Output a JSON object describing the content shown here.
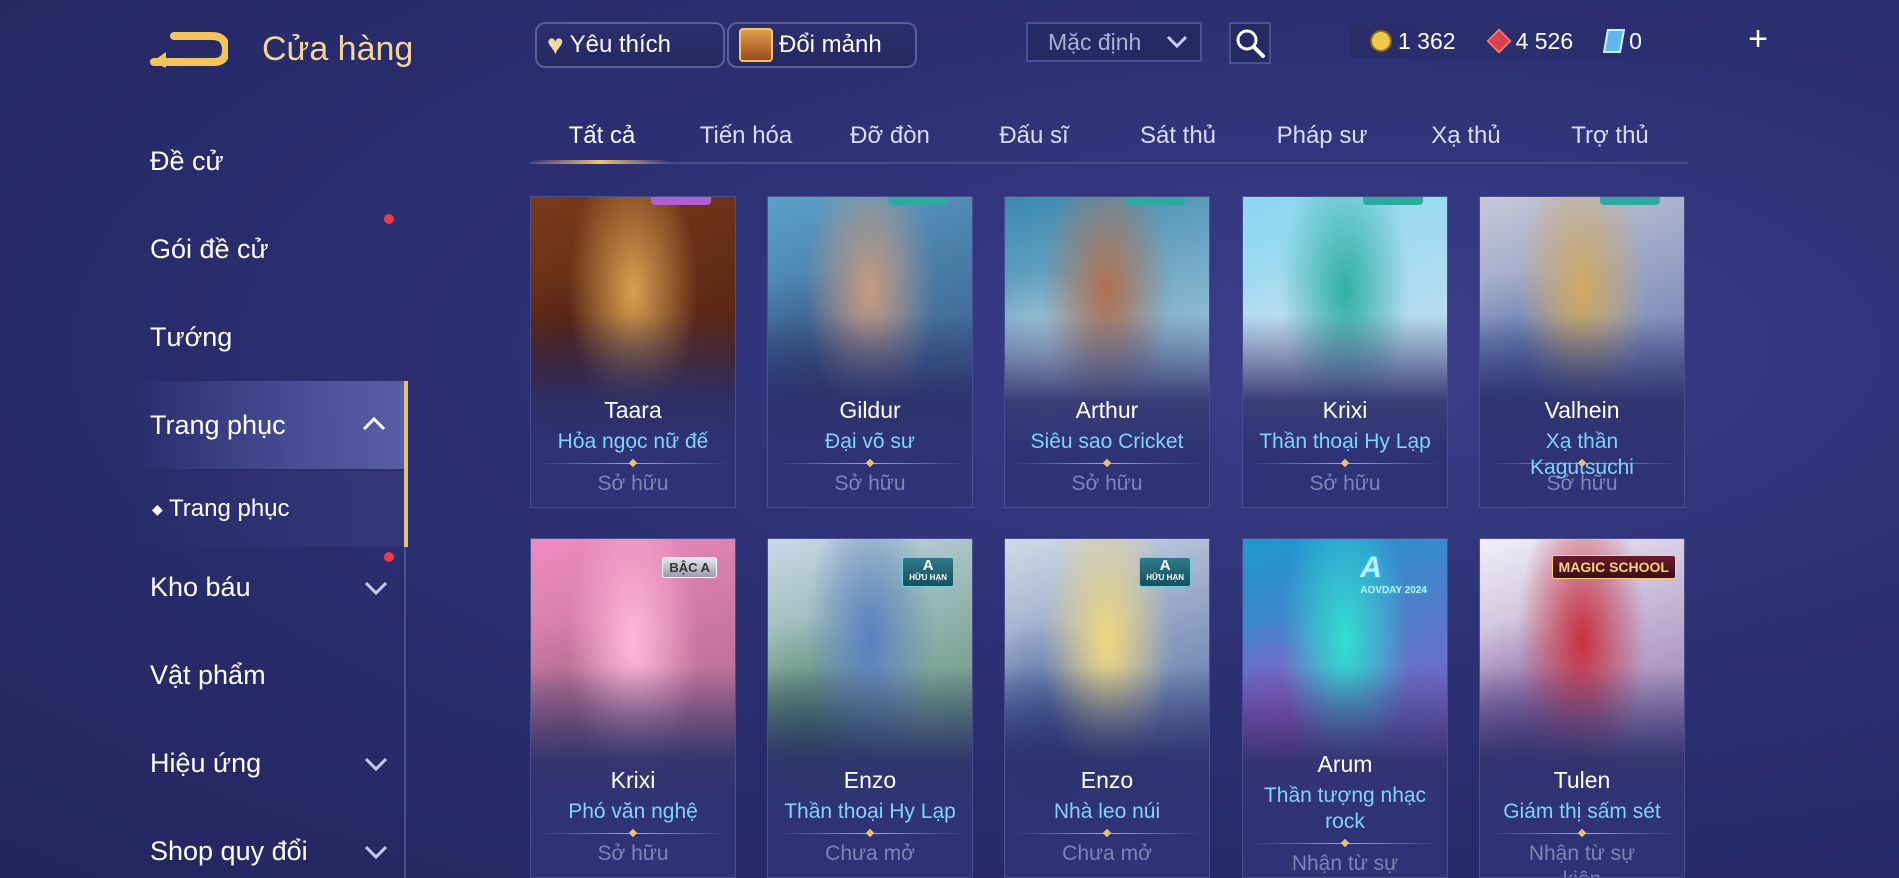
{
  "header": {
    "title": "Cửa hàng",
    "favorite_label": "Yêu thích",
    "fragment_label": "Đổi mảnh",
    "sort": {
      "selected": "Mặc định"
    },
    "currencies": {
      "gold": "1 362",
      "gems": "4 526",
      "vouchers": "0"
    }
  },
  "sidebar": {
    "items": [
      {
        "label": "Đề cử"
      },
      {
        "label": "Gói đề cử"
      },
      {
        "label": "Tướng"
      },
      {
        "label": "Trang phục"
      },
      {
        "label": "Trang phục"
      },
      {
        "label": "Kho báu"
      },
      {
        "label": "Vật phẩm"
      },
      {
        "label": "Hiệu ứng"
      },
      {
        "label": "Shop quy đổi"
      }
    ]
  },
  "tabs": [
    {
      "label": "Tất cả"
    },
    {
      "label": "Tiến hóa"
    },
    {
      "label": "Đỡ đòn"
    },
    {
      "label": "Đấu sĩ"
    },
    {
      "label": "Sát thủ"
    },
    {
      "label": "Pháp sư"
    },
    {
      "label": "Xạ thủ"
    },
    {
      "label": "Trợ thủ"
    }
  ],
  "cards": [
    {
      "hero": "Taara",
      "skin": "Hỏa ngọc nữ đế",
      "status": "Sở hữu",
      "colors": [
        "#7a3a1a",
        "#d8a050",
        "#3a1410"
      ]
    },
    {
      "hero": "Gildur",
      "skin": "Đại võ sư",
      "status": "Sở hữu",
      "colors": [
        "#5aa0c8",
        "#c89a80",
        "#2a3a6a"
      ]
    },
    {
      "hero": "Arthur",
      "skin": "Siêu sao Cricket",
      "status": "Sở hữu",
      "colors": [
        "#3a88b0",
        "#b07050",
        "#e0e8f0"
      ]
    },
    {
      "hero": "Krixi",
      "skin": "Thần thoại Hy Lạp",
      "status": "Sở hữu",
      "colors": [
        "#88d8f0",
        "#2fb0a0",
        "#e8e0f0"
      ]
    },
    {
      "hero": "Valhein",
      "skin": "Xạ thần Kagutsuchi",
      "status": "Sở hữu",
      "colors": [
        "#c8c8d8",
        "#d0a860",
        "#3a5aa0"
      ]
    },
    {
      "hero": "Krixi",
      "skin": "Phó văn nghệ",
      "status": "Sở hữu",
      "badge": "BẬC A",
      "colors": [
        "#f08ac0",
        "#ffb8d8",
        "#8a5a70"
      ]
    },
    {
      "hero": "Enzo",
      "skin": "Thần thoại Hy Lạp",
      "status": "Chưa mở",
      "badge": "A",
      "badge_sub": "HỮU HẠN",
      "colors": [
        "#c8d8e8",
        "#5a80c0",
        "#2a6a3a"
      ]
    },
    {
      "hero": "Enzo",
      "skin": "Nhà leo núi",
      "status": "Chưa mở",
      "badge": "A",
      "badge_sub": "HỮU HẠN",
      "colors": [
        "#d0dae8",
        "#f0d880",
        "#1a3a80"
      ]
    },
    {
      "hero": "Arum",
      "skin": "Thần tượng nhạc rock",
      "status": "Nhận từ sự kiện",
      "badge": "A",
      "badge_sub": "AOVDAY 2024",
      "colors": [
        "#1a9ad0",
        "#30e0d0",
        "#c040c0"
      ]
    },
    {
      "hero": "Tulen",
      "skin": "Giám thị sấm sét",
      "status": "Nhận từ sự kiện",
      "badge": "MAGIC SCHOOL",
      "colors": [
        "#f0f0f8",
        "#c83040",
        "#6a3a8a"
      ]
    }
  ]
}
